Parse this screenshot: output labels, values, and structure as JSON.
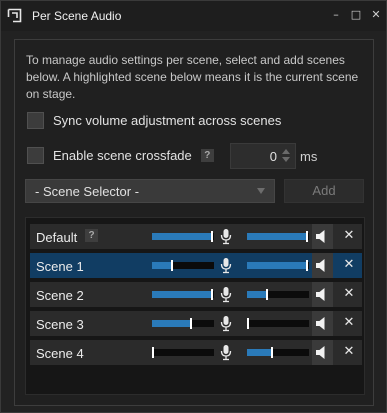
{
  "window": {
    "title": "Per Scene Audio",
    "controls": {
      "minimize": "–",
      "maximize": "□",
      "close": "✕"
    }
  },
  "description": "To manage audio settings per scene, select and add scenes below. A highlighted scene below means it is the current scene on stage.",
  "options": {
    "sync_volume_label": "Sync volume adjustment across scenes",
    "sync_volume_checked": false,
    "crossfade_label": "Enable scene crossfade",
    "crossfade_checked": false,
    "crossfade_help": "?",
    "crossfade_ms_value": "0",
    "ms_unit": "ms"
  },
  "scene_selector": {
    "value": "- Scene Selector -",
    "add_label": "Add"
  },
  "colors": {
    "accent": "#2a7ab9",
    "selected_row": "#113d63",
    "background": "#202020"
  },
  "scenes": [
    {
      "name": "Default",
      "help": "?",
      "volume": 0.95,
      "monitor": 0.95,
      "selected": false,
      "removable": true
    },
    {
      "name": "Scene 1",
      "volume": 0.3,
      "monitor": 0.95,
      "selected": true,
      "removable": true
    },
    {
      "name": "Scene 2",
      "volume": 0.95,
      "monitor": 0.3,
      "selected": false,
      "removable": true
    },
    {
      "name": "Scene 3",
      "volume": 0.62,
      "monitor": 0.0,
      "selected": false,
      "removable": true
    },
    {
      "name": "Scene 4",
      "volume": 0.0,
      "monitor": 0.38,
      "selected": false,
      "removable": true
    }
  ],
  "icons": {
    "app": "app-logo-icon",
    "mic": "microphone-icon",
    "speaker": "speaker-icon",
    "remove": "close-icon"
  },
  "remove_glyph": "✕"
}
